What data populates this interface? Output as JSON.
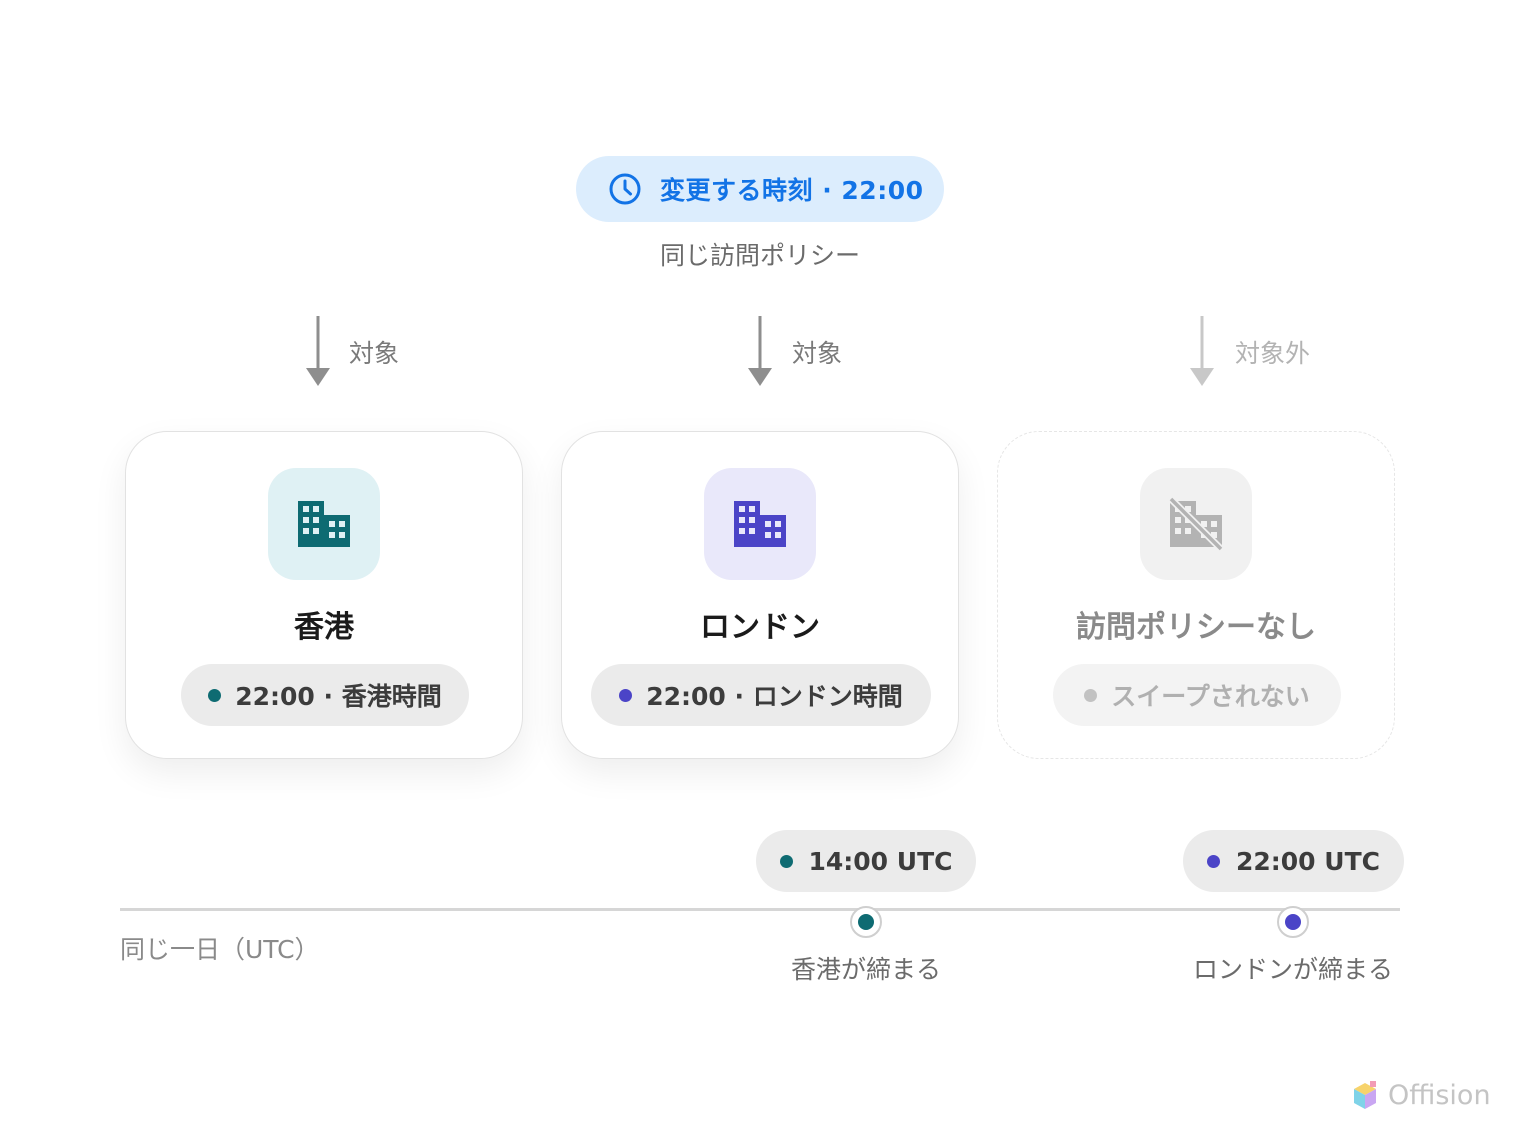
{
  "header": {
    "pill_label": "変更する時刻 · 22:00",
    "subtitle": "同じ訪問ポリシー",
    "accent": "#1273e6"
  },
  "arrows": [
    {
      "label": "対象"
    },
    {
      "label": "対象"
    },
    {
      "label": "対象外"
    }
  ],
  "cards": [
    {
      "title": "香港",
      "badge": "22:00 · 香港時間",
      "icon": "building-icon",
      "color": "#0e6b72",
      "bg": "#dff1f4"
    },
    {
      "title": "ロンドン",
      "badge": "22:00 · ロンドン時間",
      "icon": "building-icon",
      "color": "#4b44c7",
      "bg": "#e9e8fa"
    },
    {
      "title": "訪問ポリシーなし",
      "badge": "スイープされない",
      "icon": "building-off-icon",
      "color": "#b3b3b3",
      "bg": "#f1f1f1"
    }
  ],
  "timeline": {
    "axis_label": "同じ一日（UTC）",
    "events": [
      {
        "time": "14:00 UTC",
        "label": "香港が締まる",
        "color": "#0e6b72"
      },
      {
        "time": "22:00 UTC",
        "label": "ロンドンが締まる",
        "color": "#4b44c7"
      }
    ]
  },
  "brand": {
    "name": "Offision"
  }
}
